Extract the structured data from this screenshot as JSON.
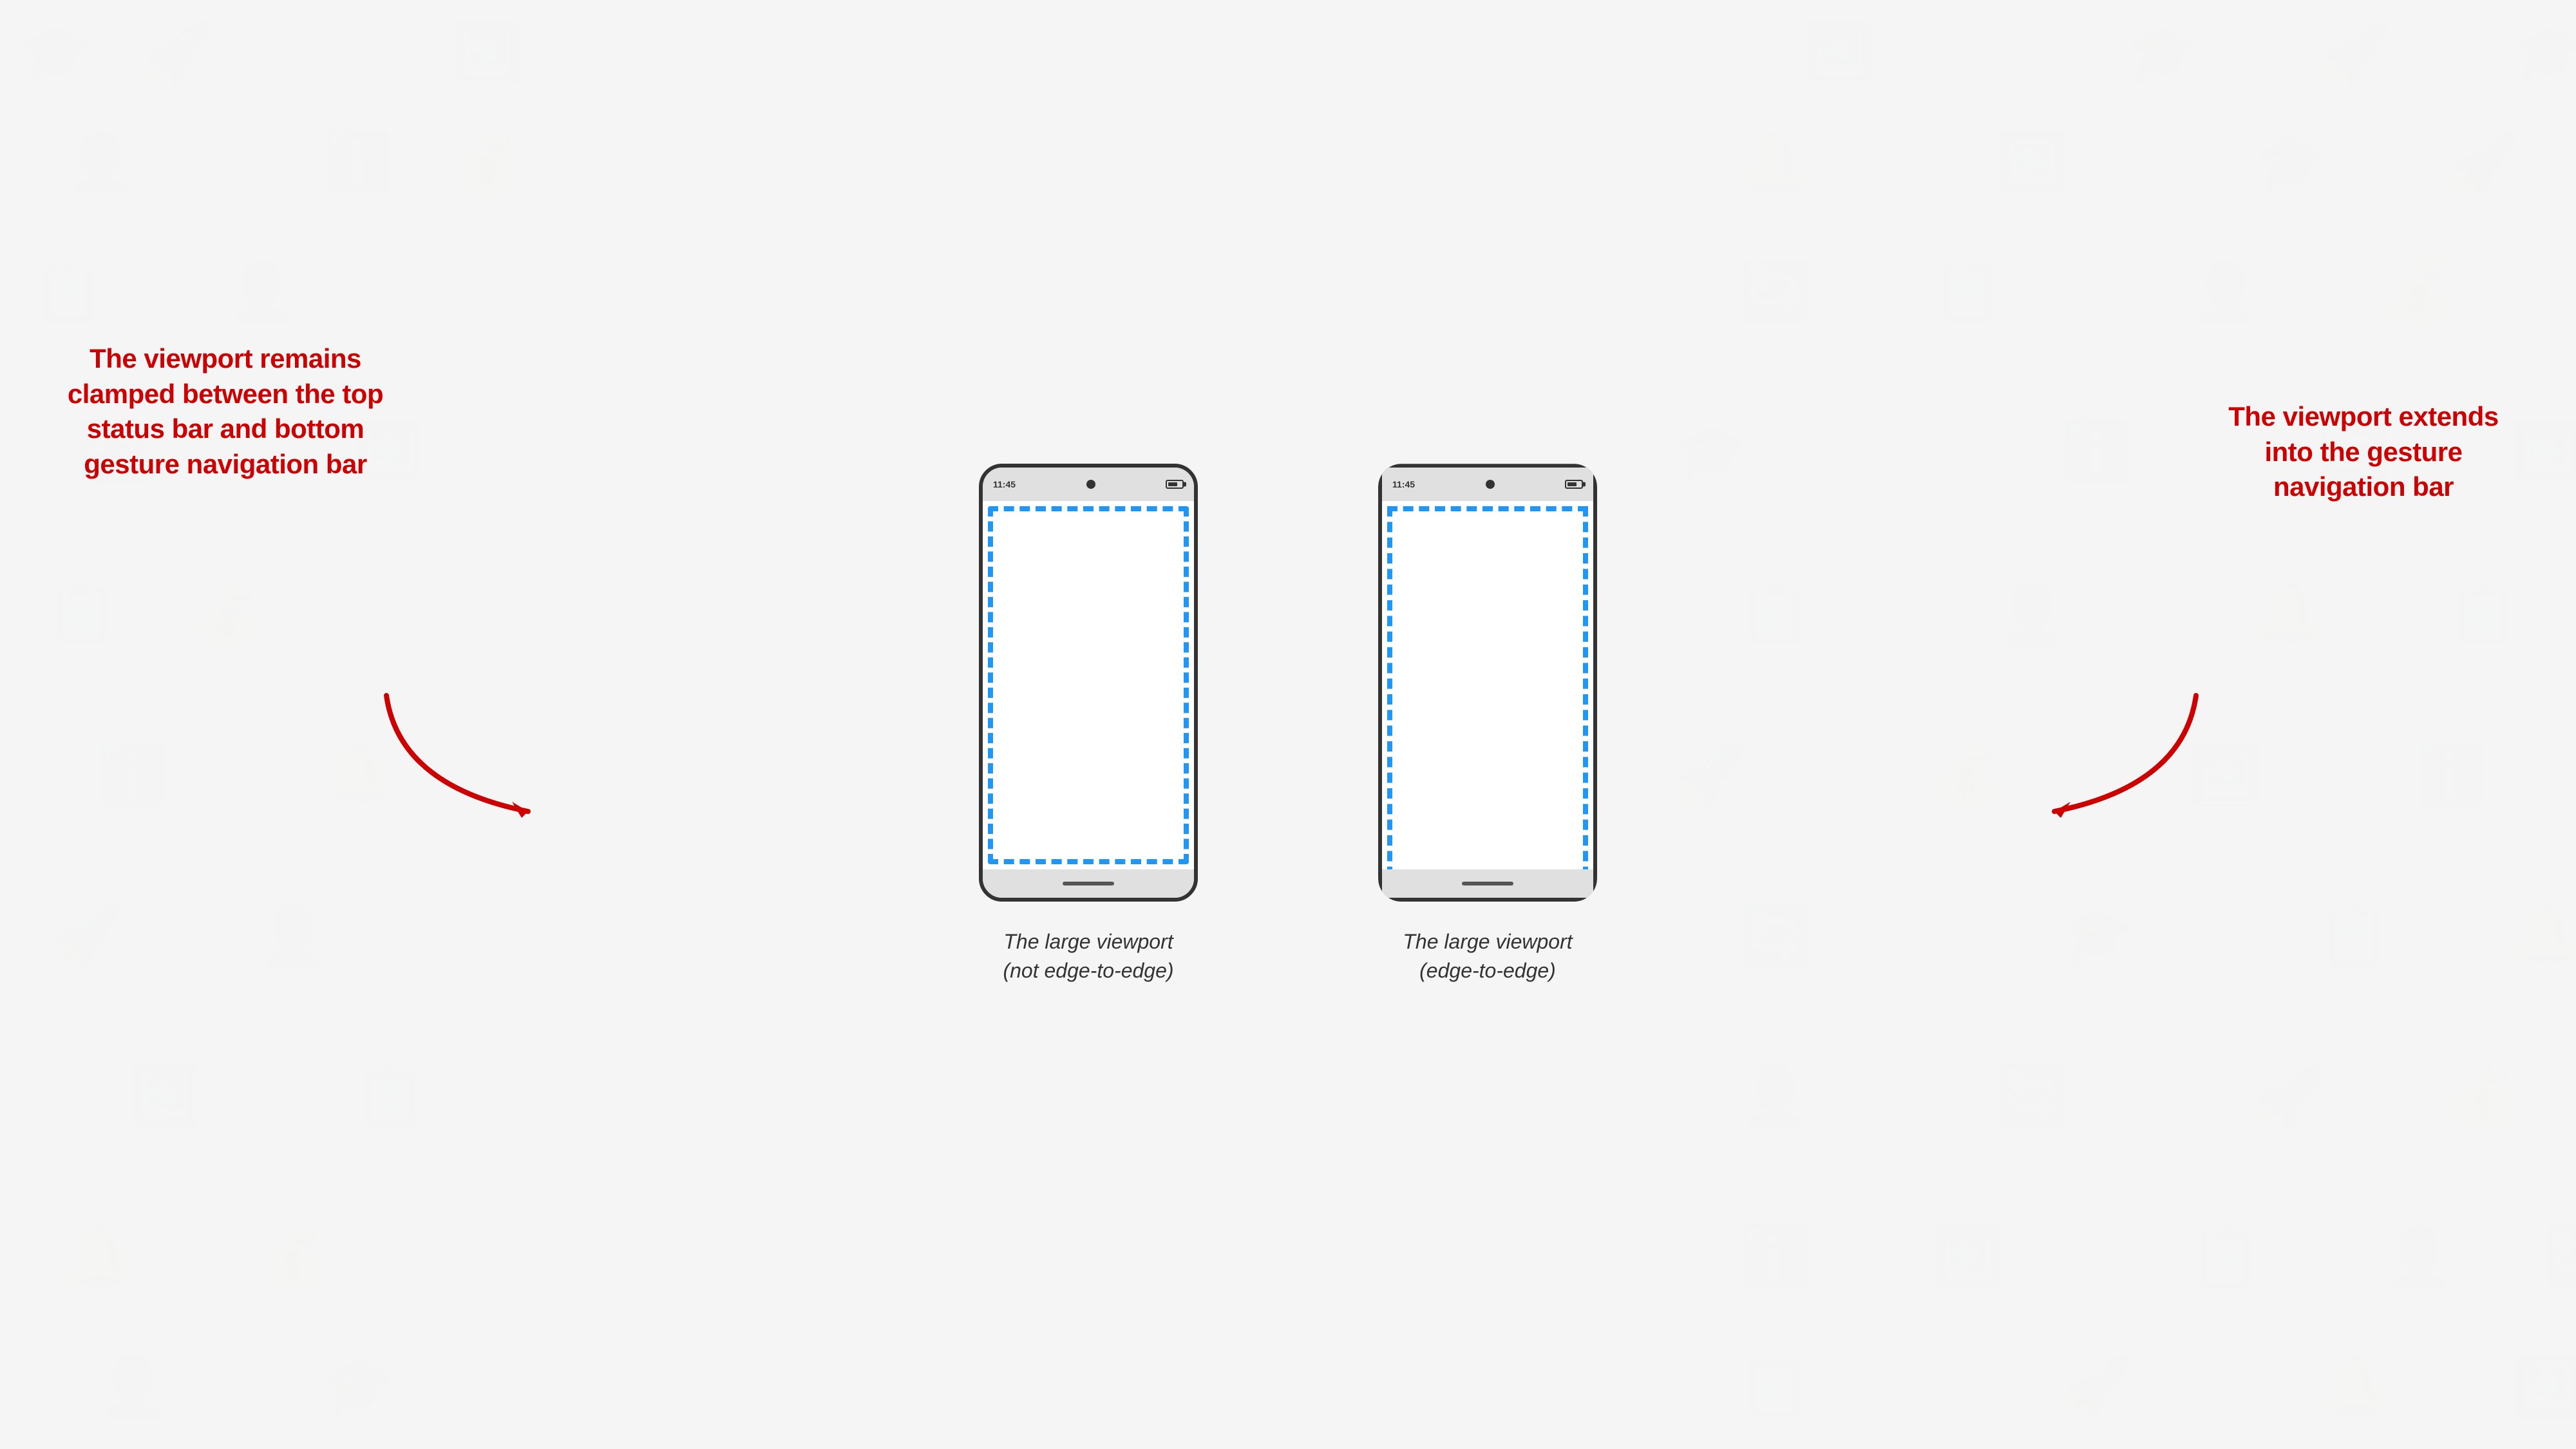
{
  "background": {
    "color": "#f0f0f0"
  },
  "phones": [
    {
      "id": "not-edge-to-edge",
      "status_time": "11:45",
      "caption_line1": "The large viewport",
      "caption_line2": "(not edge-to-edge)"
    },
    {
      "id": "edge-to-edge",
      "status_time": "11:45",
      "caption_line1": "The large viewport",
      "caption_line2": "(edge-to-edge)"
    }
  ],
  "annotations": {
    "left": {
      "text": "The viewport remains clamped between the top status bar and bottom gesture navigation bar"
    },
    "right": {
      "text": "The viewport extends into the gesture navigation bar"
    }
  },
  "captions": {
    "phone1_line1": "The large viewport",
    "phone1_line2": "(not edge-to-edge)",
    "phone2_line1": "The large viewport",
    "phone2_line2": "(edge-to-edge)"
  }
}
